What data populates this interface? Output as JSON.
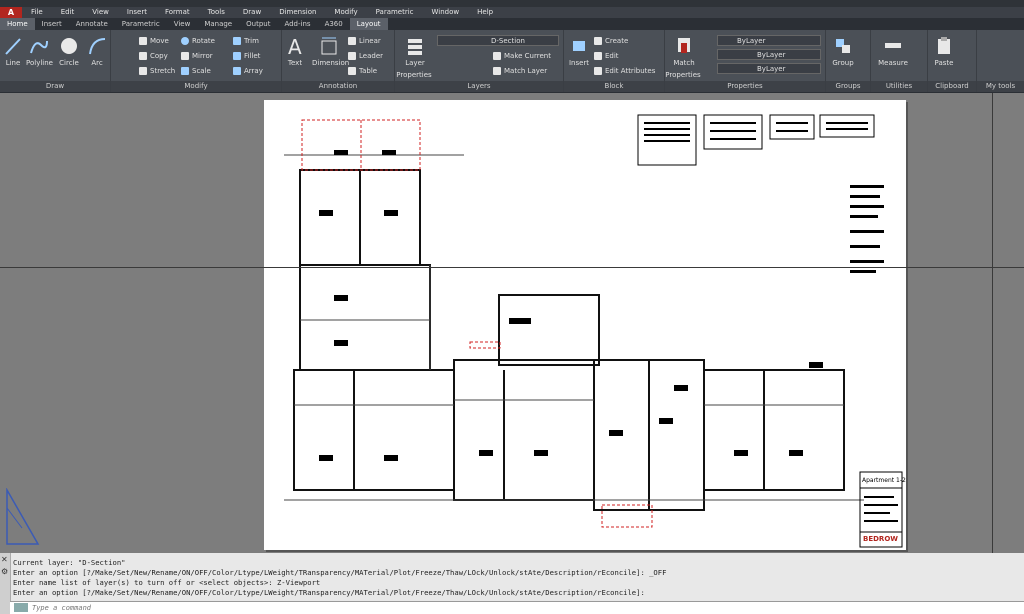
{
  "app": {
    "logo": "A"
  },
  "menu": [
    "File",
    "Edit",
    "View",
    "Insert",
    "Format",
    "Tools",
    "Draw",
    "Dimension",
    "Modify",
    "Parametric",
    "Window",
    "Help"
  ],
  "tabs": [
    {
      "label": "Home",
      "active": true
    },
    {
      "label": "Insert"
    },
    {
      "label": "Annotate"
    },
    {
      "label": "Parametric"
    },
    {
      "label": "View"
    },
    {
      "label": "Manage"
    },
    {
      "label": "Output"
    },
    {
      "label": "Add-ins"
    },
    {
      "label": "A360"
    },
    {
      "label": "Layout"
    }
  ],
  "ribbon": {
    "draw": {
      "title": "Draw",
      "line": "Line",
      "polyline": "Polyline",
      "circle": "Circle",
      "arc": "Arc"
    },
    "modify": {
      "title": "Modify",
      "move": "Move",
      "rotate": "Rotate",
      "trim": "Trim",
      "copy": "Copy",
      "mirror": "Mirror",
      "fillet": "Fillet",
      "stretch": "Stretch",
      "scale": "Scale",
      "array": "Array"
    },
    "annotation": {
      "title": "Annotation",
      "text": "Text",
      "dimension": "Dimension",
      "linear": "Linear",
      "leader": "Leader",
      "table": "Table"
    },
    "layers": {
      "title": "Layers",
      "layer_properties_1": "Layer",
      "layer_properties_2": "Properties",
      "current_layer": "D-Section",
      "make_current": "Make Current",
      "match_layer": "Match Layer"
    },
    "block": {
      "title": "Block",
      "insert": "Insert",
      "create": "Create",
      "edit": "Edit",
      "edit_attributes": "Edit Attributes"
    },
    "properties": {
      "title": "Properties",
      "match_1": "Match",
      "match_2": "Properties",
      "color": "ByLayer",
      "linetype": "ByLayer",
      "lineweight": "ByLayer"
    },
    "groups": {
      "title": "Groups",
      "group": "Group"
    },
    "utilities": {
      "title": "Utilities",
      "measure": "Measure"
    },
    "clipboard": {
      "title": "Clipboard",
      "paste": "Paste"
    },
    "mytools": {
      "title": "My tools"
    }
  },
  "drawing": {
    "title_block_label": "Apartment 1-2",
    "logo_text": "BEDROW"
  },
  "command": {
    "lines": [
      "Current layer:  \"D-Section\"",
      "Enter an option [?/Make/Set/New/Rename/ON/OFF/Color/Ltype/LWeight/TRansparency/MATerial/Plot/Freeze/Thaw/LOck/Unlock/stAte/Description/rEconcile]: _OFF",
      "Enter name list of layer(s) to turn off or <select objects>: Z-Viewport",
      "Enter an option [?/Make/Set/New/Rename/ON/OFF/Color/Ltype/LWeight/TRansparency/MATerial/Plot/Freeze/Thaw/LOck/Unlock/stAte/Description/rEconcile]:"
    ],
    "placeholder": "Type a command"
  },
  "colors": {
    "accent_red": "#b2261f",
    "ribbon_bg": "#4b5057",
    "canvas_bg": "#7d7d7d"
  }
}
